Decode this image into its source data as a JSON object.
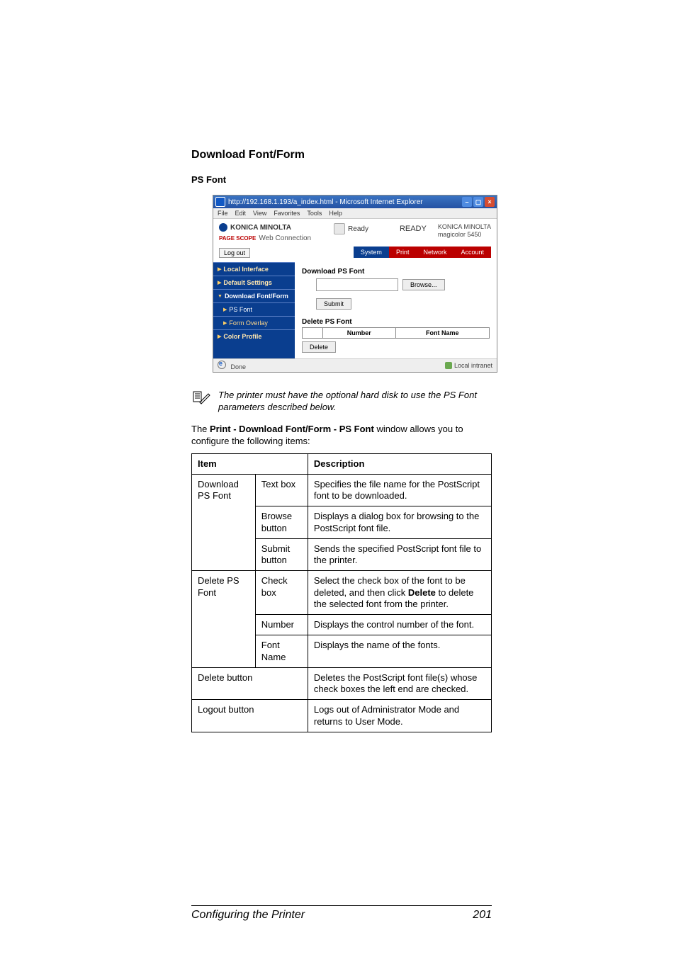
{
  "heading": "Download Font/Form",
  "subheading": "PS Font",
  "screenshot": {
    "titlebar": "http://192.168.1.193/a_index.html - Microsoft Internet Explorer",
    "menu": {
      "file": "File",
      "edit": "Edit",
      "view": "View",
      "favorites": "Favorites",
      "tools": "Tools",
      "help": "Help"
    },
    "header": {
      "logo": "KONICA MINOLTA",
      "subbrand_prefix": "PAGE SCOPE",
      "subbrand": "Web Connection",
      "status_label": "Ready",
      "status_big": "READY",
      "model_line1": "KONICA MINOLTA",
      "model_line2": "magicolor 5450"
    },
    "logout_label": "Log out",
    "tabs": {
      "system": "System",
      "print": "Print",
      "network": "Network",
      "account": "Account"
    },
    "sidebar": {
      "items": [
        "Local Interface",
        "Default Settings",
        "Download Font/Form",
        "PS Font",
        "Form Overlay",
        "Color Profile"
      ]
    },
    "content": {
      "dl_title": "Download PS Font",
      "browse": "Browse...",
      "submit": "Submit",
      "del_title": "Delete PS Font",
      "col_number": "Number",
      "col_fontname": "Font Name",
      "delete_btn": "Delete"
    },
    "statusbar": {
      "done": "Done",
      "zone": "Local intranet"
    }
  },
  "note": "The printer must have the optional hard disk to use the PS Font parameters described below.",
  "intro_pre": "The ",
  "intro_bold": "Print - Download Font/Form - PS Font",
  "intro_post": " window allows you to configure the following items:",
  "table": {
    "head_item": "Item",
    "head_desc": "Description",
    "rows": [
      {
        "g": "Download PS Font",
        "c": "Text box",
        "d": "Specifies the file name for the PostScript font to be downloaded."
      },
      {
        "g": "",
        "c": "Browse button",
        "d": "Displays a dialog box for browsing to the PostScript font file."
      },
      {
        "g": "",
        "c": "Submit button",
        "d": "Sends the specified PostScript font file to the printer."
      },
      {
        "g": "Delete PS Font",
        "c": "Check box",
        "d_pre": "Select the check box of the font to be deleted, and then click ",
        "d_bold": "Delete",
        "d_post": " to delete the selected font from the printer."
      },
      {
        "g": "",
        "c": "Number",
        "d": "Displays the control number of the font."
      },
      {
        "g": "",
        "c": "Font Name",
        "d": "Displays the name of the fonts."
      },
      {
        "g": "Delete button",
        "span": true,
        "d": "Deletes the PostScript font file(s) whose check boxes the left end are checked."
      },
      {
        "g": "Logout button",
        "span": true,
        "d": "Logs out of Administrator Mode and returns to User Mode."
      }
    ]
  },
  "footer_left": "Configuring the Printer",
  "footer_right": "201"
}
